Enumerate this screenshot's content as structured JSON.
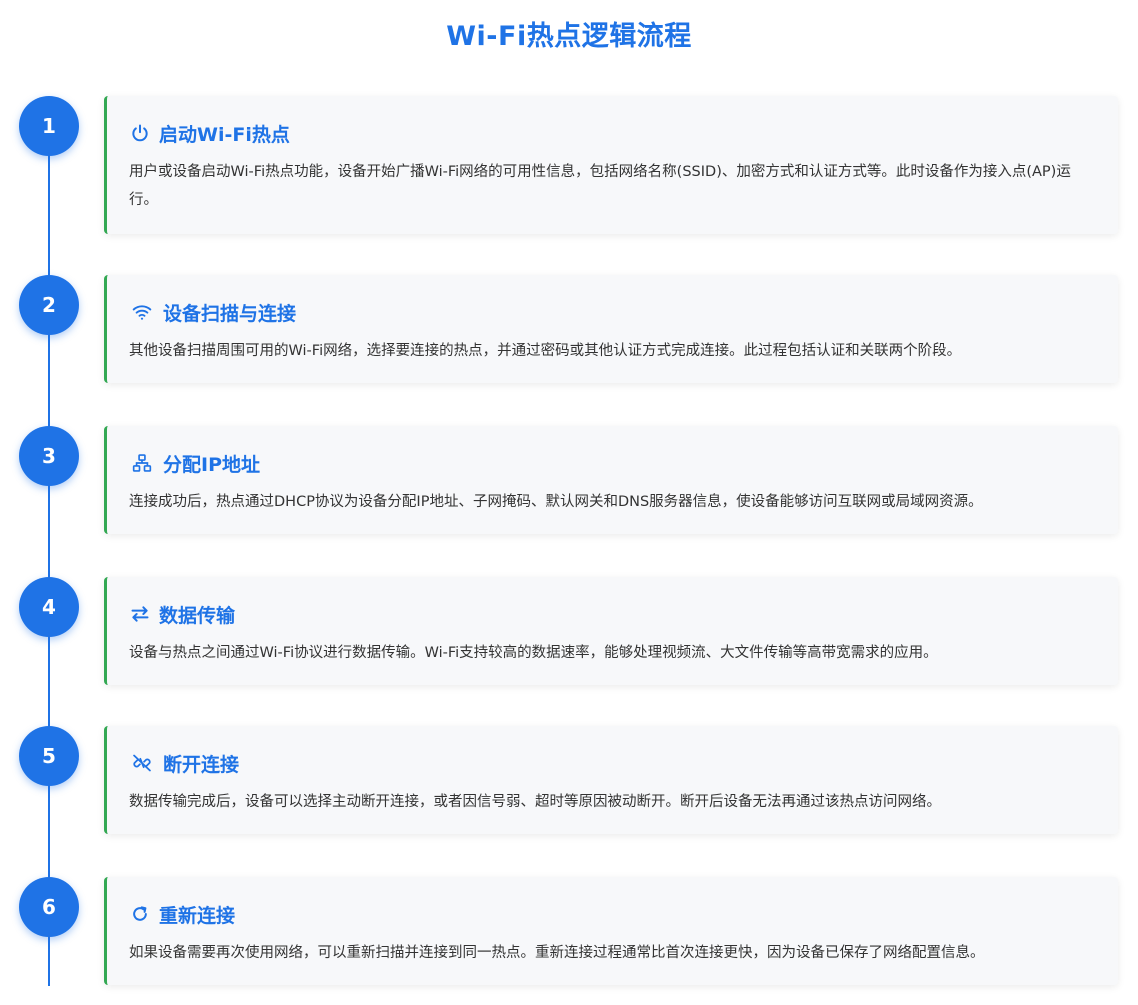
{
  "title": "Wi-Fi热点逻辑流程",
  "steps": [
    {
      "number": "1",
      "icon": "power-icon",
      "title": "启动Wi-Fi热点",
      "description": "用户或设备启动Wi-Fi热点功能，设备开始广播Wi-Fi网络的可用性信息，包括网络名称(SSID)、加密方式和认证方式等。此时设备作为接入点(AP)运行。"
    },
    {
      "number": "2",
      "icon": "wifi-icon",
      "title": "设备扫描与连接",
      "description": "其他设备扫描周围可用的Wi-Fi网络，选择要连接的热点，并通过密码或其他认证方式完成连接。此过程包括认证和关联两个阶段。"
    },
    {
      "number": "3",
      "icon": "network-icon",
      "title": "分配IP地址",
      "description": "连接成功后，热点通过DHCP协议为设备分配IP地址、子网掩码、默认网关和DNS服务器信息，使设备能够访问互联网或局域网资源。"
    },
    {
      "number": "4",
      "icon": "exchange-arrows-icon",
      "title": "数据传输",
      "description": "设备与热点之间通过Wi-Fi协议进行数据传输。Wi-Fi支持较高的数据速率，能够处理视频流、大文件传输等高带宽需求的应用。"
    },
    {
      "number": "5",
      "icon": "broken-link-icon",
      "title": "断开连接",
      "description": "数据传输完成后，设备可以选择主动断开连接，或者因信号弱、超时等原因被动断开。断开后设备无法再通过该热点访问网络。"
    },
    {
      "number": "6",
      "icon": "redo-icon",
      "title": "重新连接",
      "description": "如果设备需要再次使用网络，可以重新扫描并连接到同一热点。重新连接过程通常比首次连接更快，因为设备已保存了网络配置信息。"
    }
  ],
  "colors": {
    "accent": "#1f73e6",
    "card_border": "#33a853",
    "card_bg": "#f7f8fa"
  }
}
